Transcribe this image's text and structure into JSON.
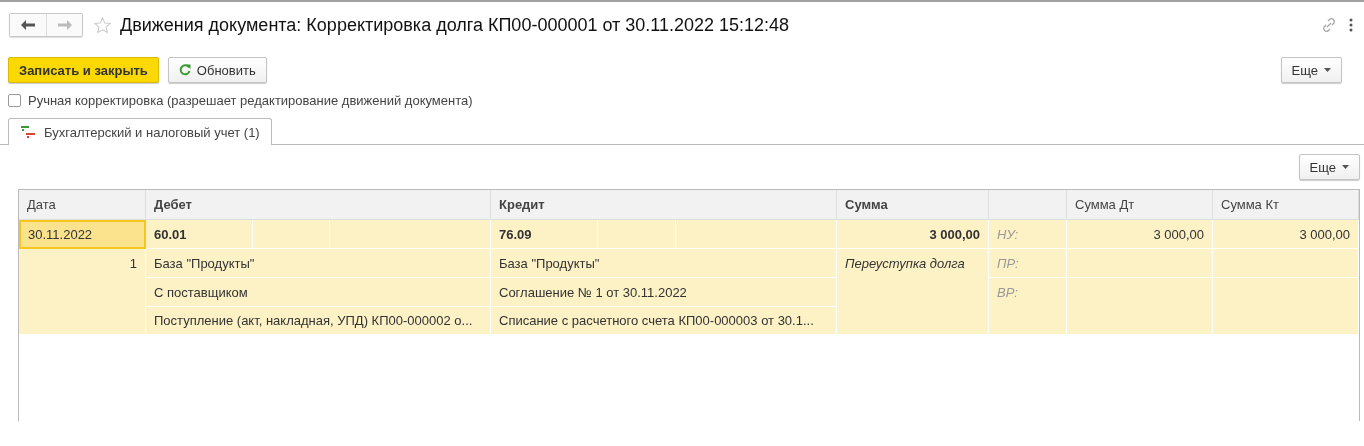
{
  "window": {
    "title": "Движения документа: Корректировка долга КП00-000001 от 30.11.2022 15:12:48",
    "favorite": false
  },
  "toolbar": {
    "buttons": [
      {
        "label": "Записать и закрыть",
        "kind": "primary"
      },
      {
        "label": "Обновить",
        "kind": "refresh"
      }
    ],
    "more": "Еще"
  },
  "manual_correction": {
    "label": "Ручная корректировка (разрешает редактирование движений документа)",
    "checked": false
  },
  "tabs": [
    {
      "label": "Бухгалтерский и налоговый учет (1)",
      "selected": true
    }
  ],
  "table_toolbar": {
    "more": "Еще"
  },
  "table": {
    "columns": [
      "Дата",
      "Дебет",
      "Кредит",
      "Сумма",
      "Сумма Дт",
      "Сумма Кт"
    ],
    "entries": [
      {
        "date": "30.11.2022",
        "selected": true,
        "number": "1",
        "debit": {
          "account": "60.01",
          "subconto": [
            "База \"Продукты\"",
            "С поставщиком",
            "Поступление (акт, накладная, УПД) КП00-000002 о..."
          ]
        },
        "credit": {
          "account": "76.09",
          "subconto": [
            "База \"Продукты\"",
            "Соглашение № 1 от 30.11.2022",
            "Списание с расчетного счета КП00-000003 от 30.1..."
          ]
        },
        "amount": "3 000,00",
        "content": "Переуступка долга",
        "tax_lines": [
          {
            "label": "НУ:",
            "debit": "3 000,00",
            "credit": "3 000,00"
          },
          {
            "label": "ПР:"
          },
          {
            "label": "ВР:"
          }
        ]
      }
    ]
  }
}
